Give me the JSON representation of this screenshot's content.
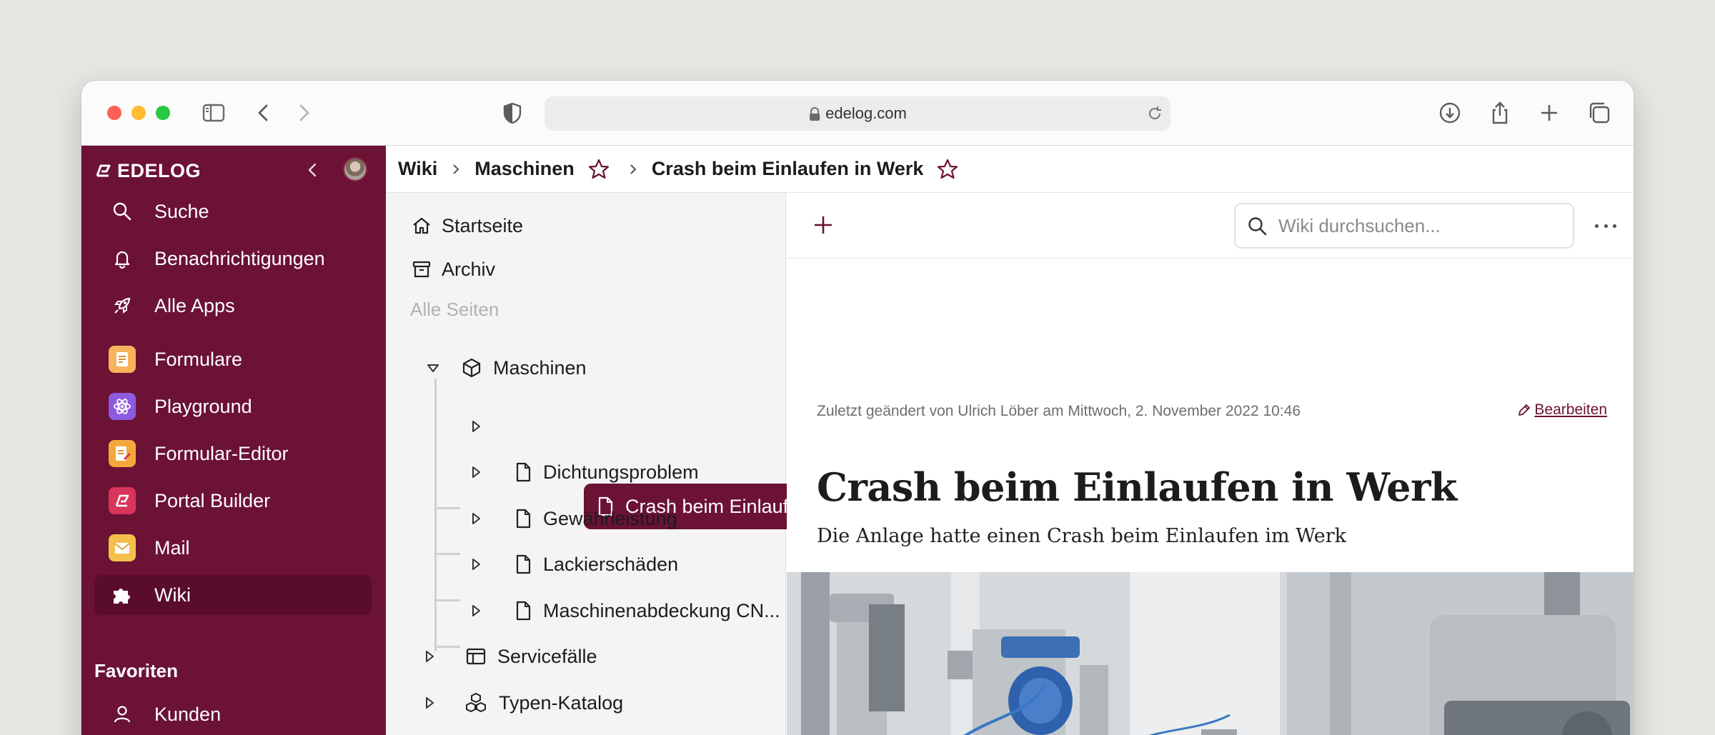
{
  "browser": {
    "url": "edelog.com"
  },
  "sidebar": {
    "brand": "EDELOG",
    "main_items": [
      {
        "label": "Suche",
        "icon": "search-icon"
      },
      {
        "label": "Benachrichtigungen",
        "icon": "bell-icon"
      },
      {
        "label": "Alle Apps",
        "icon": "rocket-icon"
      }
    ],
    "apps": [
      {
        "label": "Formulare",
        "icon": "form-app-icon",
        "color": "#f5a340"
      },
      {
        "label": "Playground",
        "icon": "atom-app-icon",
        "color": "#8a55d8"
      },
      {
        "label": "Formular-Editor",
        "icon": "form-editor-app-icon",
        "color": "#f2a33a"
      },
      {
        "label": "Portal Builder",
        "icon": "portal-app-icon",
        "color": "#d9345a"
      },
      {
        "label": "Mail",
        "icon": "mail-app-icon",
        "color": "#f2b93a"
      },
      {
        "label": "Wiki",
        "icon": "puzzle-icon",
        "active": true
      }
    ],
    "favorites_title": "Favoriten",
    "favorites": [
      {
        "label": "Kunden",
        "icon": "person-icon"
      }
    ]
  },
  "breadcrumb": {
    "items": [
      "Wiki",
      "Maschinen",
      "Crash beim Einlaufen in Werk"
    ]
  },
  "tree": {
    "home": "Startseite",
    "archive": "Archiv",
    "all_pages": "Alle Seiten",
    "root": "Maschinen",
    "children": [
      {
        "label": "Crash beim Einlaufen in ...",
        "selected": true
      },
      {
        "label": "Dichtungsproblem"
      },
      {
        "label": "Gewährleistung"
      },
      {
        "label": "Lackierschäden"
      },
      {
        "label": "Maschinenabdeckung CN..."
      }
    ],
    "other_roots": [
      {
        "label": "Servicefälle",
        "icon": "table-icon"
      },
      {
        "label": "Typen-Katalog",
        "icon": "cubes-icon"
      }
    ]
  },
  "content": {
    "search_placeholder": "Wiki durchsuchen...",
    "meta": "Zuletzt geändert von Ulrich Löber am Mittwoch, 2. November 2022 10:46",
    "edit_label": "Bearbeiten",
    "title": "Crash beim Einlaufen in Werk",
    "subtitle": "Die Anlage hatte einen Crash beim Einlaufen im Werk"
  },
  "colors": {
    "brand": "#6b1235",
    "active": "#5a0c2b"
  }
}
